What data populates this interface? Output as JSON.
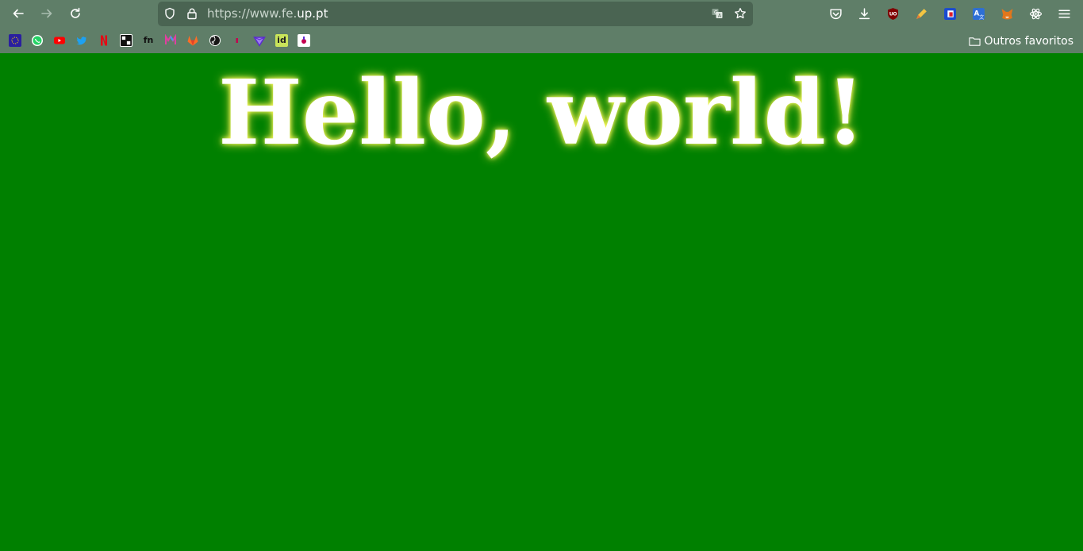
{
  "browser": {
    "url_prefix": "https://www.fe.",
    "url_host": "up.pt",
    "bookmarks": [
      {
        "name": "eu-bookmark-icon",
        "glyph": "",
        "color": "#2a1fa0"
      },
      {
        "name": "whatsapp-bookmark-icon",
        "glyph": "",
        "color": "#25d366"
      },
      {
        "name": "youtube-bookmark-icon",
        "glyph": "▶",
        "color": "#ff0000"
      },
      {
        "name": "twitter-bookmark-icon",
        "glyph": "",
        "color": "#1da1f2"
      },
      {
        "name": "netflix-bookmark-icon",
        "glyph": "N",
        "color": "#e50914"
      },
      {
        "name": "tap-bookmark-icon",
        "glyph": "",
        "color": "#111111"
      },
      {
        "name": "fn-bookmark-icon",
        "glyph": "fn",
        "color": "#111111"
      },
      {
        "name": "m-bookmark-icon",
        "glyph": "M",
        "color": "#e040a0"
      },
      {
        "name": "gitlab-bookmark-icon",
        "glyph": "",
        "color": "#fc6d26"
      },
      {
        "name": "github-bookmark-icon",
        "glyph": "",
        "color": "#181717"
      },
      {
        "name": "red-mark-bookmark-icon",
        "glyph": "",
        "color": "#c4004f"
      },
      {
        "name": "gem-bookmark-icon",
        "glyph": "",
        "color": "#5b2bd0"
      },
      {
        "name": "id-bookmark-icon",
        "glyph": "id",
        "color": "#c9e45a"
      },
      {
        "name": "app-bookmark-icon",
        "glyph": "",
        "color": "#ffffff"
      }
    ],
    "other_favorites": "Outros favoritos"
  },
  "page": {
    "heading": "Hello, world!",
    "background": "#008000"
  }
}
